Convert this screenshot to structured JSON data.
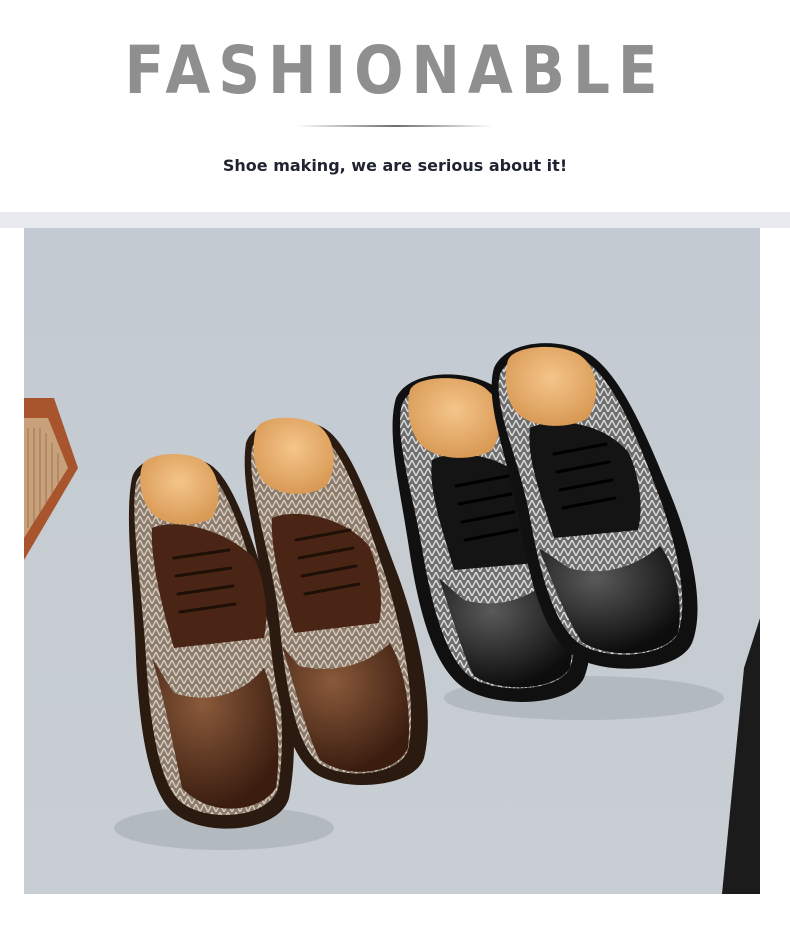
{
  "header": {
    "headline": "FASHIONABLE",
    "tagline": "Shoe making, we are serious about it!"
  },
  "photo": {
    "subject": "two-pairs-brogue-oxford-shoes",
    "colors": {
      "background": "#c6ccd2",
      "brown_leather": "#4a2515",
      "black_leather": "#141414",
      "lining": "#e4ad6a"
    }
  }
}
